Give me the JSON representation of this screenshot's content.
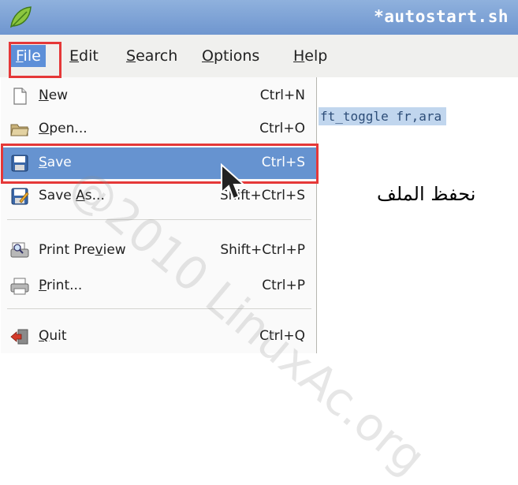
{
  "window": {
    "title": "*autostart.sh"
  },
  "menubar": [
    {
      "id": "file",
      "pre": "",
      "mn": "F",
      "post": "ile"
    },
    {
      "id": "edit",
      "pre": "",
      "mn": "E",
      "post": "dit"
    },
    {
      "id": "search",
      "pre": "",
      "mn": "S",
      "post": "earch"
    },
    {
      "id": "options",
      "pre": "",
      "mn": "O",
      "post": "ptions"
    },
    {
      "id": "help",
      "pre": "",
      "mn": "H",
      "post": "elp"
    }
  ],
  "editor": {
    "selected_text": "ft_toggle fr,ara",
    "arabic_annotation": "نحفظ الملف"
  },
  "file_menu": [
    {
      "id": "new",
      "icon": "new-document-icon",
      "pre": "",
      "mn": "N",
      "post": "ew",
      "shortcut": "Ctrl+N"
    },
    {
      "id": "open",
      "icon": "folder-open-icon",
      "pre": "",
      "mn": "O",
      "post": "pen...",
      "shortcut": "Ctrl+O"
    },
    {
      "id": "save",
      "icon": "save-icon",
      "pre": "",
      "mn": "S",
      "post": "ave",
      "shortcut": "Ctrl+S",
      "highlighted": true
    },
    {
      "id": "save-as",
      "icon": "save-as-icon",
      "pre": "Save ",
      "mn": "A",
      "post": "s...",
      "shortcut": "Shift+Ctrl+S"
    },
    {
      "id": "print-preview",
      "icon": "print-preview-icon",
      "pre": "Print Pre",
      "mn": "v",
      "post": "iew",
      "shortcut": "Shift+Ctrl+P"
    },
    {
      "id": "print",
      "icon": "printer-icon",
      "pre": "",
      "mn": "P",
      "post": "rint...",
      "shortcut": "Ctrl+P"
    },
    {
      "id": "quit",
      "icon": "quit-icon",
      "pre": "",
      "mn": "Q",
      "post": "uit",
      "shortcut": "Ctrl+Q"
    }
  ],
  "watermark": "@2010 LinuxAc.org",
  "colors": {
    "menu_highlight": "#6693d0",
    "annotation_red": "#e53838",
    "titlebar": "#7aa0d6"
  }
}
